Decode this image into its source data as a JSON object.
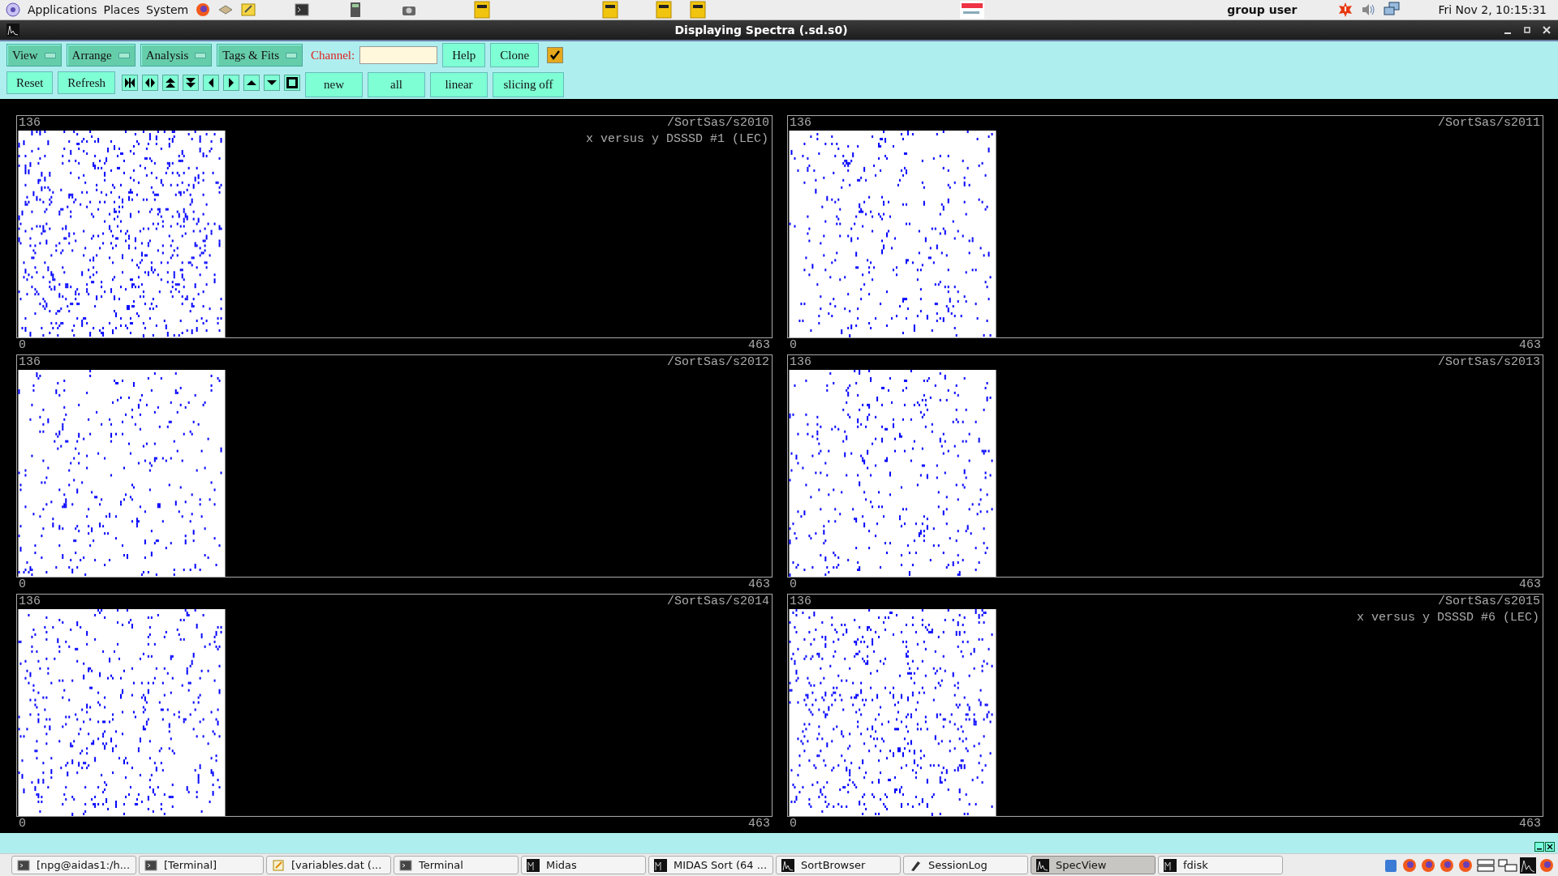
{
  "top_panel": {
    "menus": [
      "Applications",
      "Places",
      "System"
    ],
    "user": "group user",
    "clock": "Fri Nov  2, 10:15:31"
  },
  "window": {
    "title": "Displaying Spectra (.sd.s0)"
  },
  "toolbar": {
    "menus": [
      "View",
      "Arrange",
      "Analysis",
      "Tags & Fits"
    ],
    "channel": {
      "label": "Channel:"
    },
    "buttons_row1": [
      "Help",
      "Clone"
    ],
    "checkbox": {
      "checked": true
    },
    "buttons_row2": [
      "Reset",
      "Refresh"
    ],
    "toggles": [
      "new",
      "all",
      "linear",
      "slicing off"
    ]
  },
  "panels": [
    {
      "path": "/SortSas/s2010",
      "subtitle": "x versus y DSSSD #1 (LEC)",
      "y_max": "136",
      "x_min": "0",
      "x_max": "463"
    },
    {
      "path": "/SortSas/s2011",
      "y_max": "136",
      "x_min": "0",
      "x_max": "463"
    },
    {
      "path": "/SortSas/s2012",
      "y_max": "136",
      "x_min": "0",
      "x_max": "463"
    },
    {
      "path": "/SortSas/s2013",
      "y_max": "136",
      "x_min": "0",
      "x_max": "463"
    },
    {
      "path": "/SortSas/s2014",
      "y_max": "136",
      "x_min": "0",
      "x_max": "463"
    },
    {
      "path": "/SortSas/s2015",
      "subtitle": "x versus y DSSSD #6 (LEC)",
      "y_max": "136",
      "x_min": "0",
      "x_max": "463"
    }
  ],
  "taskbar": [
    {
      "label": "[npg@aidas1:/h...",
      "kind": "terminal",
      "selected": false
    },
    {
      "label": "[Terminal]",
      "kind": "terminal",
      "selected": false
    },
    {
      "label": "[variables.dat (...",
      "kind": "editor",
      "selected": false
    },
    {
      "label": "Terminal",
      "kind": "terminal",
      "selected": false
    },
    {
      "label": "Midas",
      "kind": "midas",
      "selected": false
    },
    {
      "label": "MIDAS Sort (64 ...",
      "kind": "midas",
      "selected": false
    },
    {
      "label": "SortBrowser",
      "kind": "wave",
      "selected": false
    },
    {
      "label": "SessionLog",
      "kind": "tool",
      "selected": false
    },
    {
      "label": "SpecView",
      "kind": "wave",
      "selected": true
    },
    {
      "label": "fdisk",
      "kind": "midas",
      "selected": false
    }
  ]
}
